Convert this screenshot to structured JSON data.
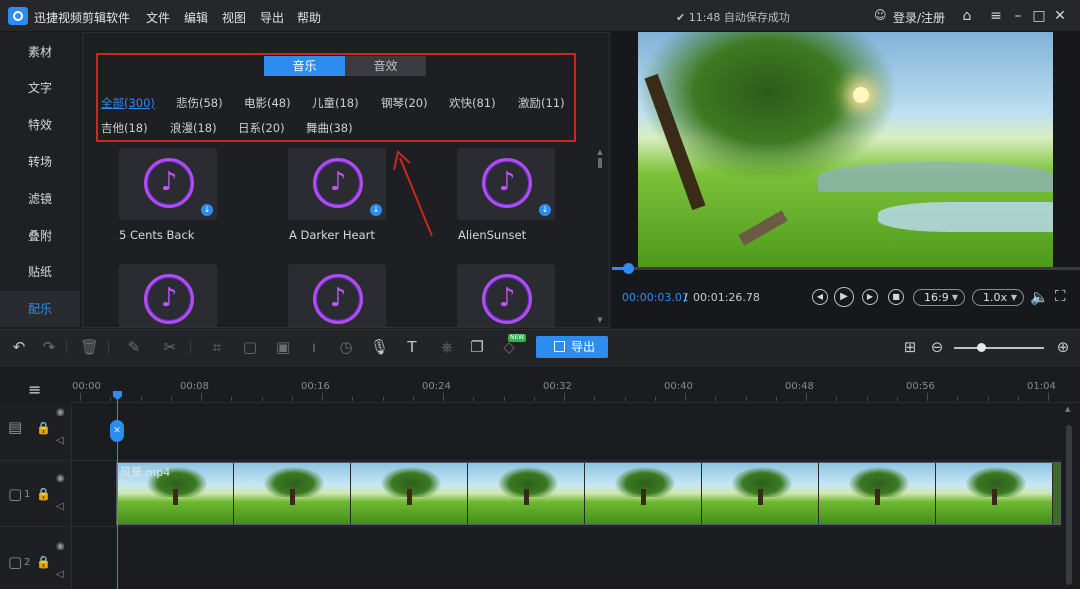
{
  "app": {
    "title": "迅捷视频剪辑软件",
    "menu": [
      "文件",
      "编辑",
      "视图",
      "导出",
      "帮助"
    ],
    "save_status": "✔ 11:48 自动保存成功",
    "login": "登录/注册"
  },
  "sidebar": {
    "items": [
      {
        "label": "素材"
      },
      {
        "label": "文字"
      },
      {
        "label": "特效"
      },
      {
        "label": "转场"
      },
      {
        "label": "滤镜"
      },
      {
        "label": "叠附"
      },
      {
        "label": "贴纸"
      },
      {
        "label": "配乐"
      }
    ],
    "active": "配乐"
  },
  "library": {
    "tabs": [
      "音乐",
      "音效"
    ],
    "active_tab": "音乐",
    "categories": [
      "全部(300)",
      "悲伤(58)",
      "电影(48)",
      "儿童(18)",
      "钢琴(20)",
      "欢快(81)",
      "激励(11)",
      "吉他(18)",
      "浪漫(18)",
      "日系(20)",
      "舞曲(38)"
    ],
    "active_category": "全部(300)",
    "cards": [
      "5 Cents Back",
      "A Darker Heart",
      "AlienSunset",
      "",
      "",
      ""
    ],
    "highlight_color": "#c9281e"
  },
  "preview": {
    "time_current": "00:00:03.01",
    "time_separator": "/",
    "time_total": "00:01:26.78",
    "aspect": "16:9",
    "speed": "1.0x",
    "progress": 0.035
  },
  "toolbar": {
    "export_label": "导出",
    "new_badge": "NEW"
  },
  "timeline": {
    "ticks": [
      "00:00",
      "00:08",
      "00:16",
      "00:24",
      "00:32",
      "00:40",
      "00:48",
      "00:56",
      "01:04"
    ],
    "clip_name": "风景.mp4",
    "track_numbers": [
      "1",
      "2"
    ]
  },
  "colors": {
    "accent": "#2d8cf0",
    "music_icon": "#c156ff"
  }
}
